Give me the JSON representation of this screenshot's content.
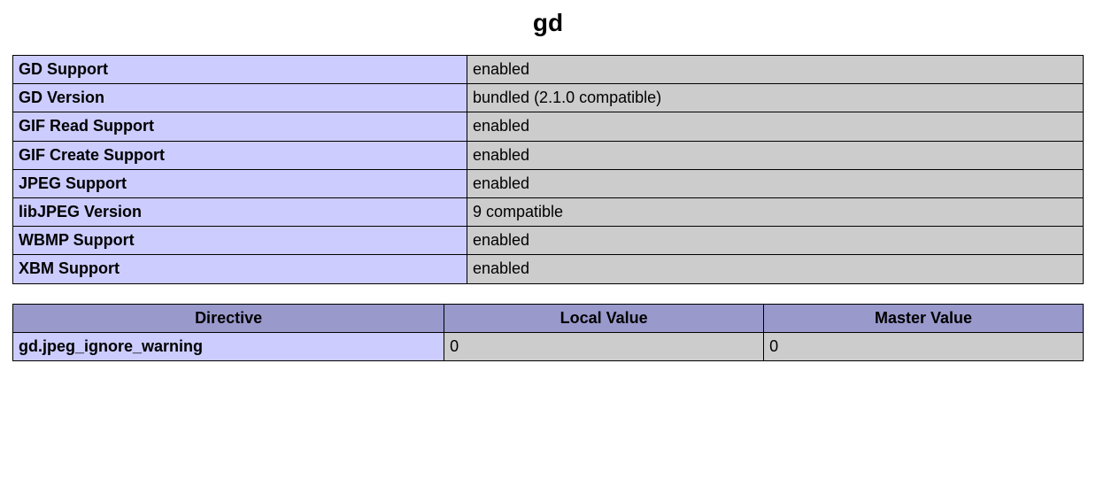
{
  "section": {
    "title": "gd"
  },
  "info_table": {
    "rows": [
      {
        "label": "GD Support",
        "value": "enabled"
      },
      {
        "label": "GD Version",
        "value": "bundled (2.1.0 compatible)"
      },
      {
        "label": "GIF Read Support",
        "value": "enabled"
      },
      {
        "label": "GIF Create Support",
        "value": "enabled"
      },
      {
        "label": "JPEG Support",
        "value": "enabled"
      },
      {
        "label": "libJPEG Version",
        "value": "9 compatible"
      },
      {
        "label": "WBMP Support",
        "value": "enabled"
      },
      {
        "label": "XBM Support",
        "value": "enabled"
      }
    ]
  },
  "directive_table": {
    "headers": {
      "directive": "Directive",
      "local": "Local Value",
      "master": "Master Value"
    },
    "rows": [
      {
        "directive": "gd.jpeg_ignore_warning",
        "local": "0",
        "master": "0"
      }
    ]
  }
}
